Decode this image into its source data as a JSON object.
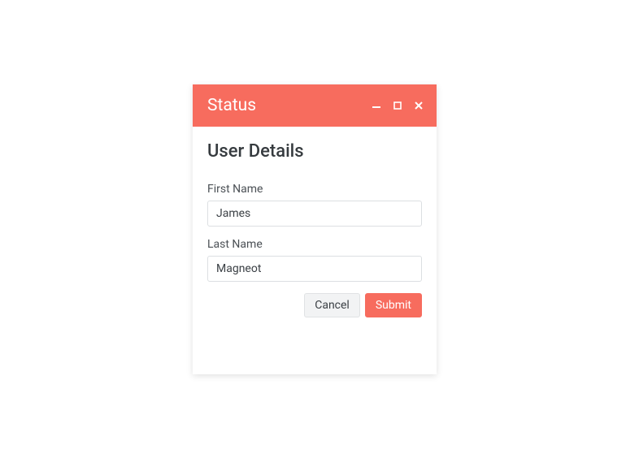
{
  "window": {
    "title": "Status"
  },
  "content": {
    "heading": "User Details",
    "first_name_label": "First Name",
    "first_name_value": "James",
    "last_name_label": "Last Name",
    "last_name_value": "Magneot"
  },
  "buttons": {
    "cancel": "Cancel",
    "submit": "Submit"
  }
}
